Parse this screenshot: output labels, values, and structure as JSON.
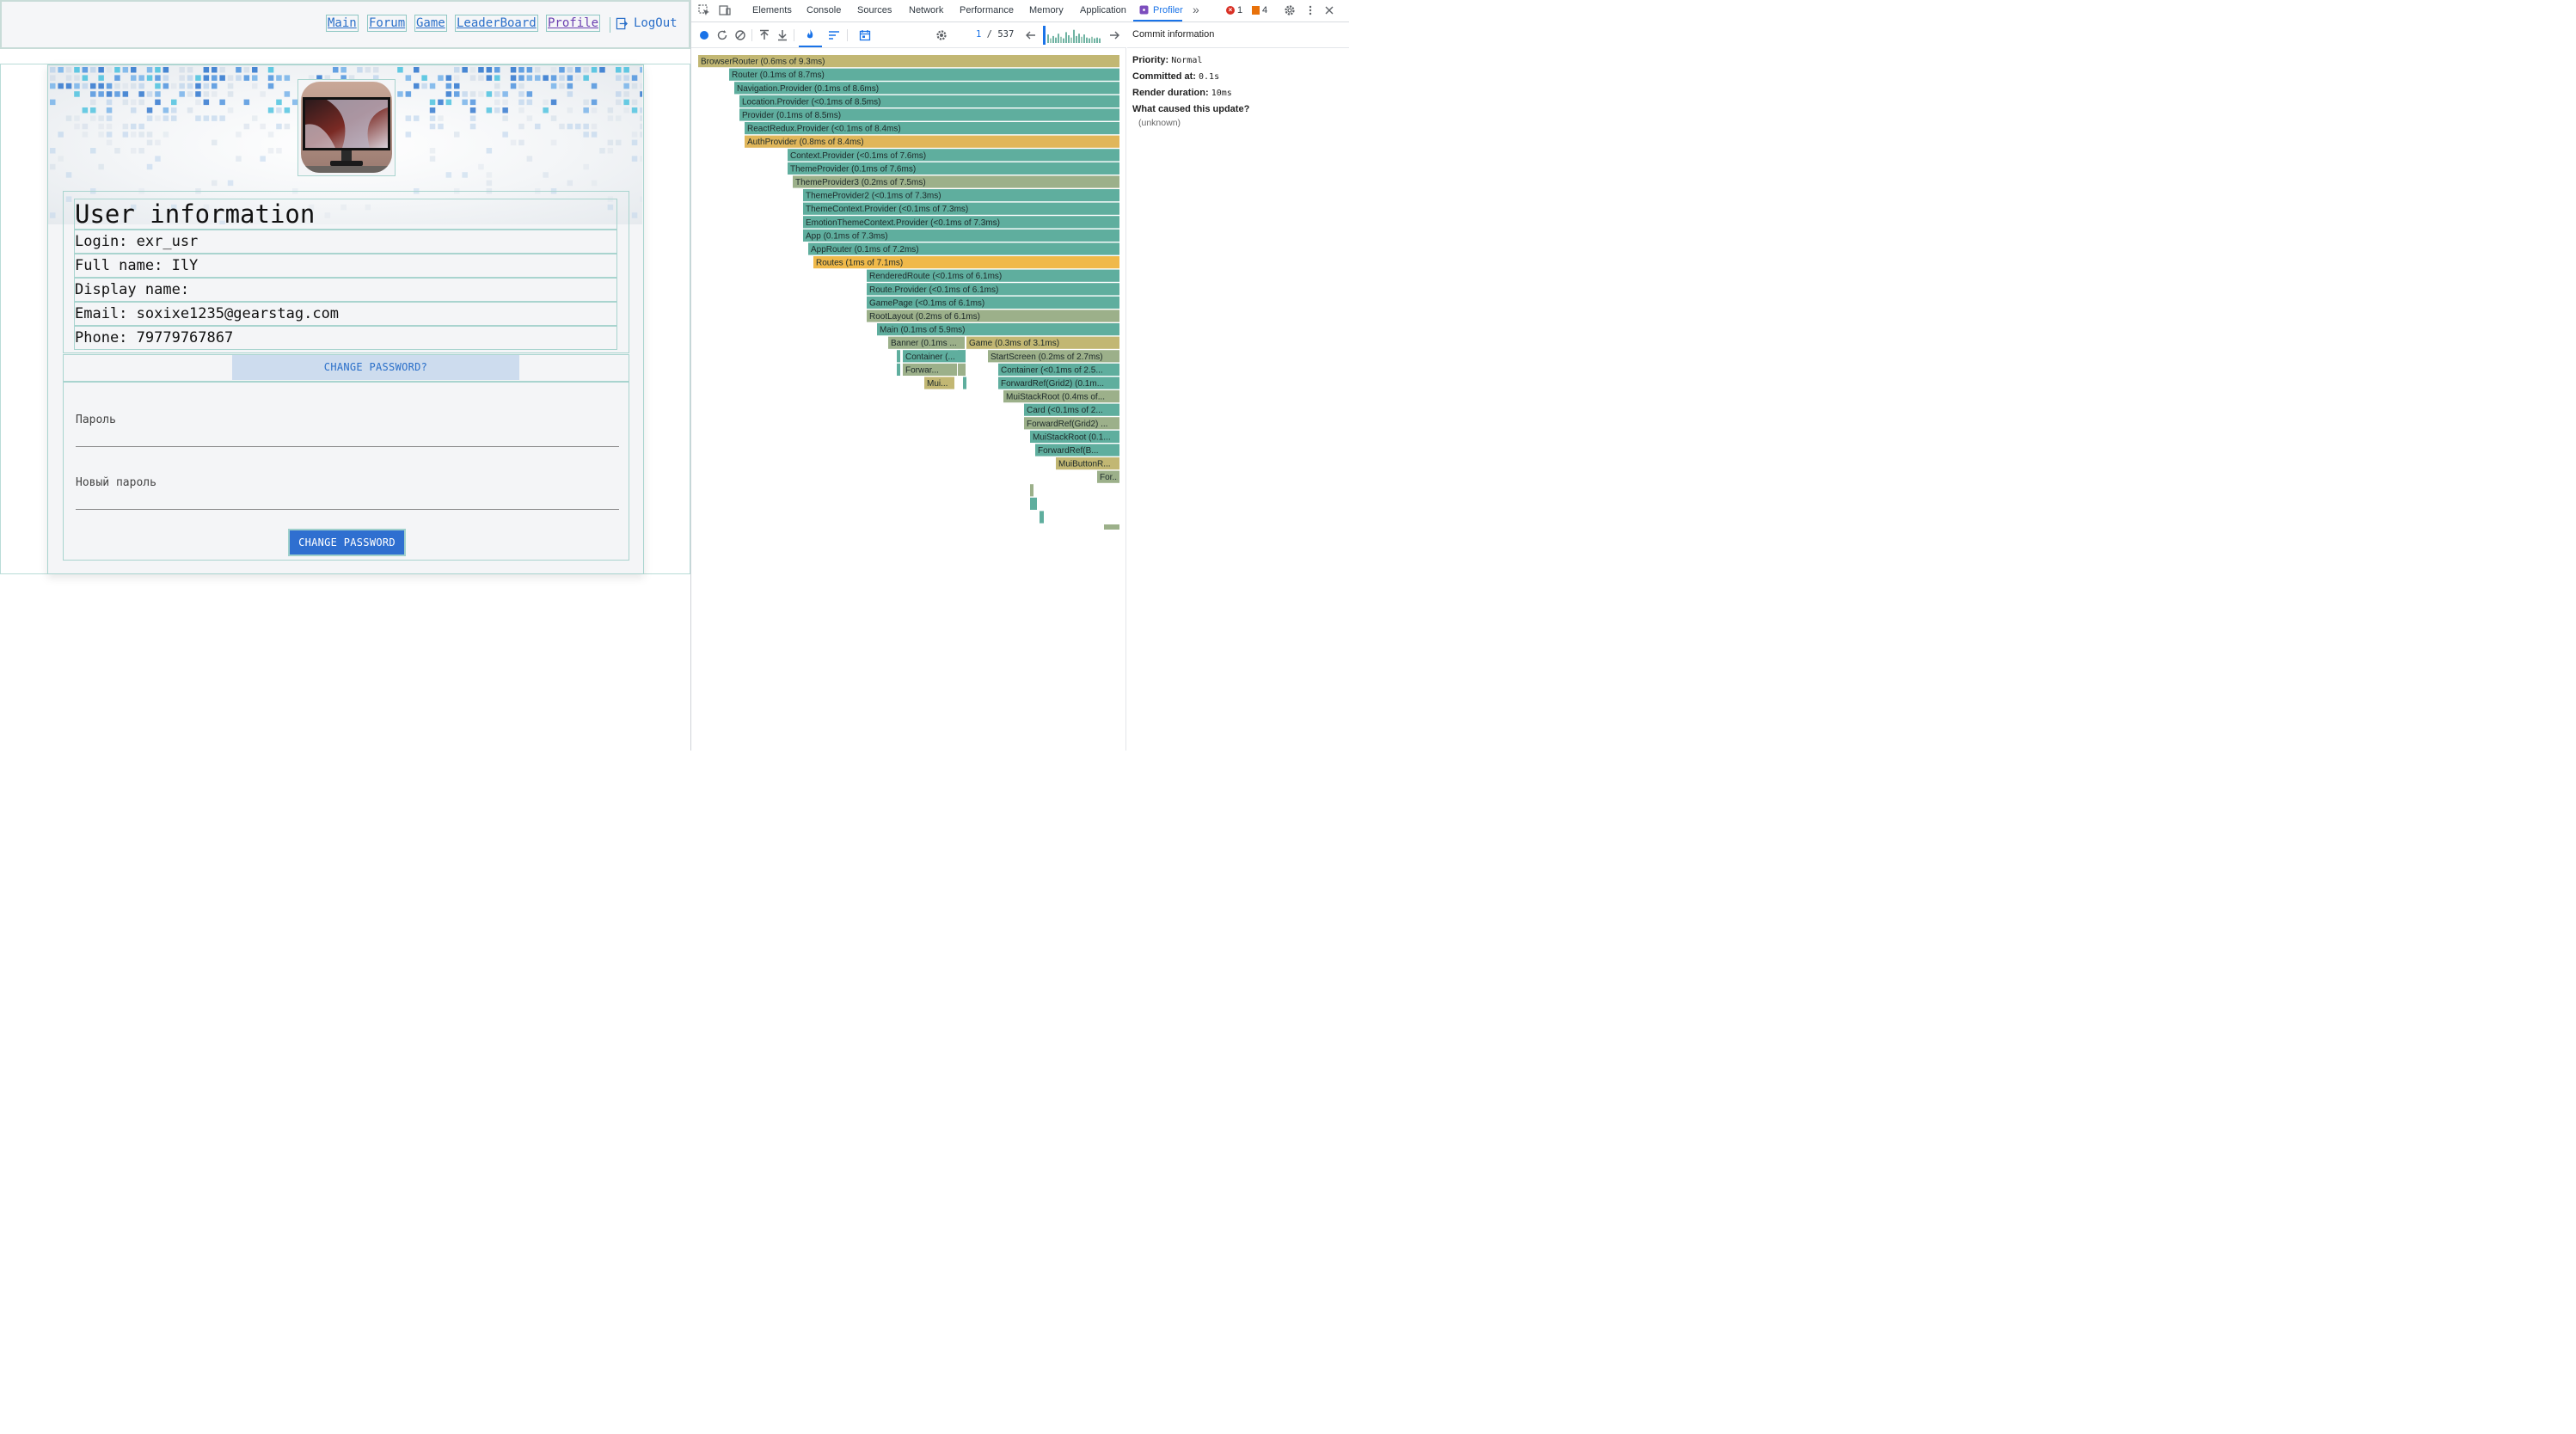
{
  "nav": {
    "links": [
      "Main",
      "Forum",
      "Game",
      "LeaderBoard",
      "Profile"
    ],
    "logout": "LogOut"
  },
  "profile": {
    "title": "User information",
    "rows": [
      "Login: exr_usr",
      "Full name: IlY",
      "Display name:",
      "Email: soxixe1235@gearstag.com",
      "Phone: 79779767867"
    ],
    "change_password_toggle": "CHANGE PASSWORD?",
    "password_label": "Пароль",
    "new_password_label": "Новый пароль",
    "submit_label": "CHANGE PASSWORD"
  },
  "devtools": {
    "tabs": [
      "Elements",
      "Console",
      "Sources",
      "Network",
      "Performance",
      "Memory",
      "Application",
      "Profiler"
    ],
    "active_tab": "Profiler",
    "error_count": "1",
    "warning_count": "4",
    "commit_index": "1",
    "commit_total": "537",
    "commit_bar_levels": [
      0.55,
      0.3,
      0.45,
      0.35,
      0.6,
      0.4,
      0.3,
      0.7,
      0.5,
      0.35,
      0.85,
      0.45,
      0.6,
      0.4,
      0.55,
      0.35,
      0.3,
      0.4,
      0.3,
      0.35,
      0.3
    ],
    "flamegraph": [
      {
        "label": "BrowserRouter (0.6ms of 9.3ms)",
        "color": "#c2b773"
      },
      {
        "label": "Router (0.1ms of 8.7ms)",
        "color": "#5fae9e"
      },
      {
        "label": "Navigation.Provider (0.1ms of 8.6ms)",
        "color": "#5fae9e"
      },
      {
        "label": "Location.Provider (<0.1ms of 8.5ms)",
        "color": "#5fae9e"
      },
      {
        "label": "Provider (0.1ms of 8.5ms)",
        "color": "#5fae9e"
      },
      {
        "label": "ReactRedux.Provider (<0.1ms of 8.4ms)",
        "color": "#5fae9e"
      },
      {
        "label": "AuthProvider (0.8ms of 8.4ms)",
        "color": "#e0b65a"
      },
      {
        "label": "Context.Provider (<0.1ms of 7.6ms)",
        "color": "#5fae9e"
      },
      {
        "label": "ThemeProvider (0.1ms of 7.6ms)",
        "color": "#5fae9e"
      },
      {
        "label": "ThemeProvider3 (0.2ms of 7.5ms)",
        "color": "#9cb08a"
      },
      {
        "label": "ThemeProvider2 (<0.1ms of 7.3ms)",
        "color": "#5fae9e"
      },
      {
        "label": "ThemeContext.Provider (<0.1ms of 7.3ms)",
        "color": "#5fae9e"
      },
      {
        "label": "EmotionThemeContext.Provider (<0.1ms of 7.3ms)",
        "color": "#5fae9e"
      },
      {
        "label": "App (0.1ms of 7.3ms)",
        "color": "#5fae9e"
      },
      {
        "label": "AppRouter (0.1ms of 7.2ms)",
        "color": "#5fae9e"
      },
      {
        "label": "Routes (1ms of 7.1ms)",
        "color": "#f0b94a"
      },
      {
        "label": "RenderedRoute (<0.1ms of 6.1ms)",
        "color": "#5fae9e"
      },
      {
        "label": "Route.Provider (<0.1ms of 6.1ms)",
        "color": "#5fae9e"
      },
      {
        "label": "GamePage (<0.1ms of 6.1ms)",
        "color": "#5fae9e"
      },
      {
        "label": "RootLayout (0.2ms of 6.1ms)",
        "color": "#9cb08a"
      },
      {
        "label": "Main (0.1ms of 5.9ms)",
        "color": "#5fae9e"
      },
      {
        "label": "Banner (0.1ms ...",
        "color": "#9cb08a"
      },
      {
        "label": "Game (0.3ms of 3.1ms)",
        "color": "#c2b773"
      },
      {
        "label": "Container (...",
        "color": "#5fae9e"
      },
      {
        "label": "StartScreen (0.2ms of 2.7ms)",
        "color": "#9cb08a"
      },
      {
        "label": "Forwar...",
        "color": "#9cb08a"
      },
      {
        "label": "Container (<0.1ms of 2.5...",
        "color": "#5fae9e"
      },
      {
        "label": "Mui...",
        "color": "#c2b773"
      },
      {
        "label": "ForwardRef(Grid2) (0.1m...",
        "color": "#5fae9e"
      },
      {
        "label": "MuiStackRoot (0.4ms of...",
        "color": "#9cb08a"
      },
      {
        "label": "Card (<0.1ms of 2...",
        "color": "#5fae9e"
      },
      {
        "label": "ForwardRef(Grid2) ...",
        "color": "#9cb08a"
      },
      {
        "label": "MuiStackRoot (0.1...",
        "color": "#5fae9e"
      },
      {
        "label": "ForwardRef(B...",
        "color": "#5fae9e"
      },
      {
        "label": "MuiButtonR...",
        "color": "#c2b773"
      },
      {
        "label": "For...",
        "color": "#9cb08a"
      }
    ],
    "commit_info": {
      "title": "Commit information",
      "priority_label": "Priority:",
      "priority_value": "Normal",
      "committed_label": "Committed at:",
      "committed_value": "0.1s",
      "render_label": "Render duration:",
      "render_value": "10ms",
      "cause_label": "What caused this update?",
      "cause_value": "(unknown)"
    }
  },
  "colors": {
    "link": "#2a6fc9",
    "accent_button": "#2f6fd0",
    "outline": "#a9d4cf",
    "devtools_accent": "#1a73e8"
  }
}
